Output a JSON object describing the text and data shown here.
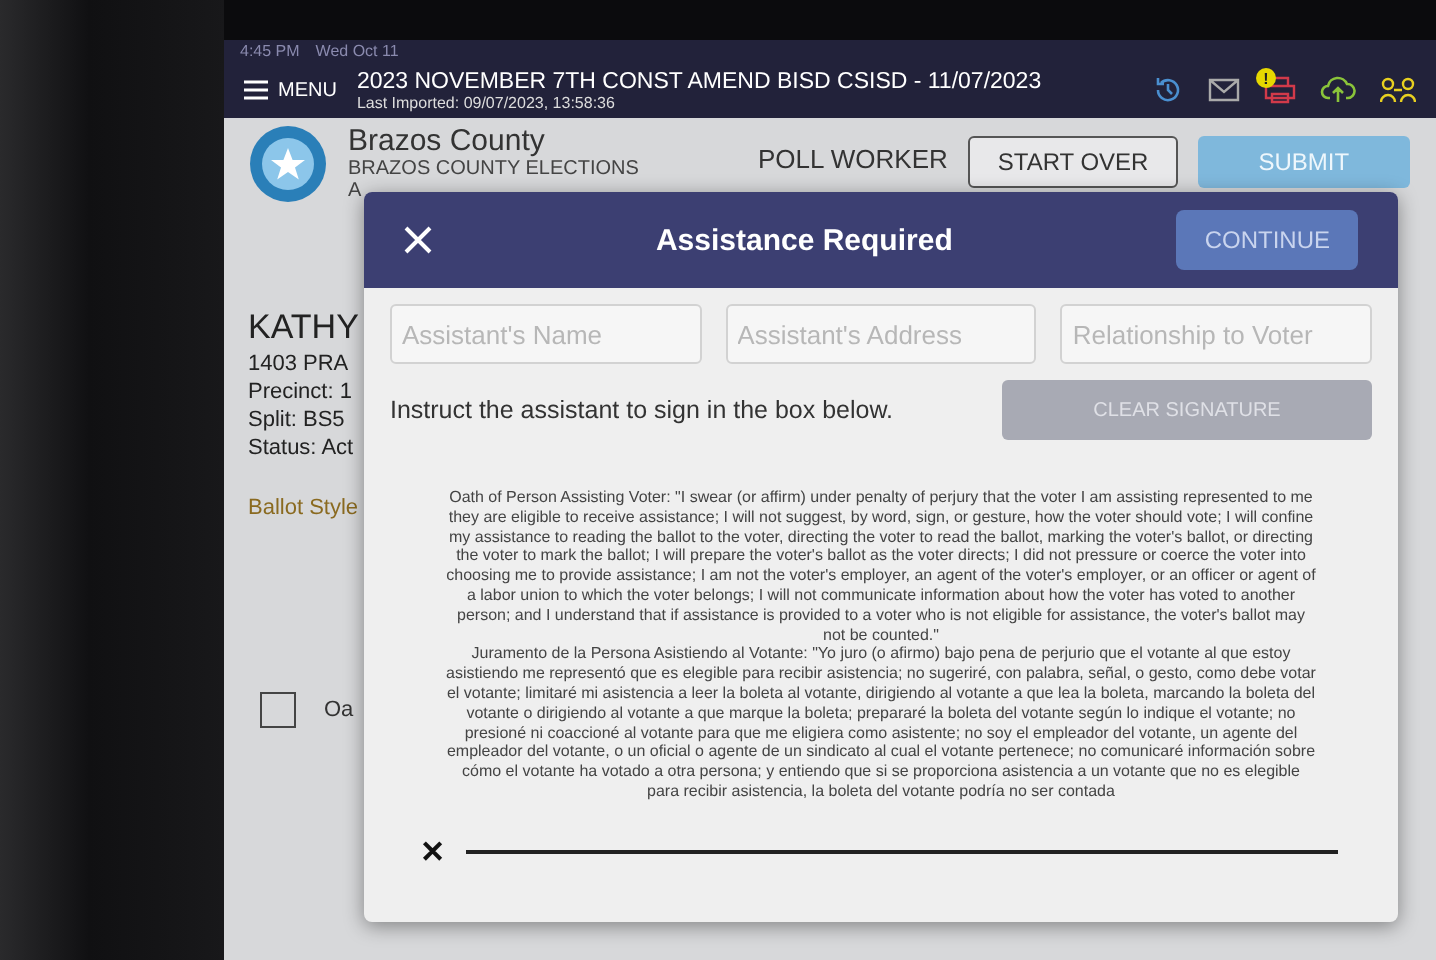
{
  "status_bar": {
    "time": "4:45 PM",
    "date": "Wed Oct 11"
  },
  "header": {
    "menu_label": "MENU",
    "election_title": "2023 NOVEMBER 7TH CONST AMEND BISD CSISD  - 11/07/2023",
    "last_imported": "Last Imported: 09/07/2023, 13:58:36",
    "alert_badge": "!"
  },
  "background": {
    "county": "Brazos County",
    "office": "BRAZOS COUNTY ELECTIONS",
    "office_line_2": "A",
    "page_title": "POLL WORKER",
    "start_over": "START OVER",
    "submit": "SUBMIT",
    "voter_name": "KATHY",
    "voter_lines": [
      "1403 PRA",
      "Precinct: 1",
      "Split: BS5",
      "Status: Act"
    ],
    "ballot_style": "Ballot Style",
    "oath_checkbox": {
      "label": "Oa",
      "checked": false
    }
  },
  "dialog": {
    "title": "Assistance Required",
    "continue": "CONTINUE",
    "continue_disabled": true,
    "fields": [
      {
        "placeholder": "Assistant's Name"
      },
      {
        "placeholder": "Assistant's Address"
      },
      {
        "placeholder": "Relationship to Voter"
      }
    ],
    "instruction": "Instruct the assistant to sign in the box below.",
    "clear_signature": "CLEAR SIGNATURE",
    "oath_paragraphs": [
      "Oath of Person Assisting Voter:  \"I swear (or affirm) under penalty of perjury that the voter I am assisting represented to me they are eligible to receive assistance; I will not suggest, by word, sign, or gesture, how the voter should vote; I will confine my assistance to reading the ballot to the voter, directing the voter to read the ballot, marking the voter's ballot, or directing the voter to mark the ballot; I will prepare the voter's ballot as the voter directs; I did not pressure or coerce the voter into choosing me to provide assistance; I am not the voter's employer, an agent of the voter's employer, or an officer or agent of a labor union to which the voter belongs; I will not communicate information about how the voter has voted to another person; and I understand that if assistance is provided to a voter who is not eligible for assistance, the voter's ballot may not be counted.\"",
      "Juramento de la Persona Asistiendo al Votante: \"Yo juro (o afirmo) bajo pena de perjurio que el votante al que estoy asistiendo me representó que es elegible para recibir asistencia; no sugeriré, con palabra, señal, o gesto, como debe votar el votante; limitaré mi asistencia a leer la boleta al votante, dirigiendo al votante a que lea la boleta, marcando la boleta del votante o dirigiendo al votante a que marque la boleta; prepararé la boleta del votante según lo indique el votante; no presioné ni coaccioné al votante para que me eligiera como asistente; no soy el empleador del votante, un agente del empleador del votante, o un oficial o agente de un sindicato al cual el votante pertenece; no comunicaré información sobre cómo el votante ha votado a otra persona; y entiendo que si se proporciona asistencia a un votante que no es elegible para recibir asistencia, la boleta del votante podría no ser contada"
    ],
    "signature_mark": "✕"
  }
}
